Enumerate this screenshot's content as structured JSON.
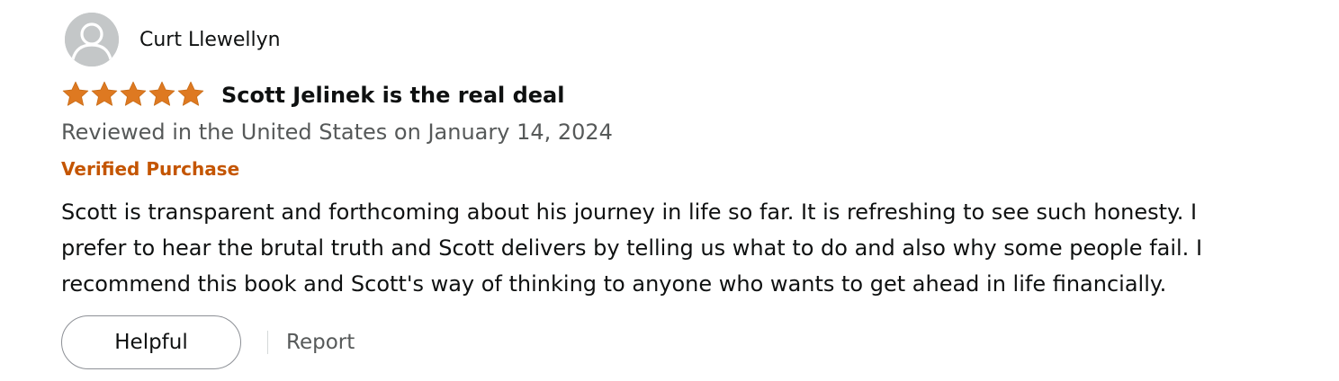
{
  "reviewer": {
    "name": "Curt Llewellyn",
    "avatar_icon": "default-user-avatar-icon"
  },
  "rating": {
    "stars": 5,
    "max_stars": 5,
    "star_icon": "star-icon",
    "star_color": "#de7921"
  },
  "review": {
    "title": "Scott Jelinek is the real deal",
    "date_line": "Reviewed in the United States on January 14, 2024",
    "verified_label": "Verified Purchase",
    "body_lines": [
      "Scott is transparent and forthcoming about his journey in life so far. It is refreshing to see such honesty. I",
      "prefer to hear the brutal truth and Scott delivers by telling us what to do and also why some people fail. I",
      "recommend this book and Scott's way of thinking to anyone who wants to get ahead in life financially."
    ]
  },
  "actions": {
    "helpful_label": "Helpful",
    "report_label": "Report"
  },
  "colors": {
    "text": "#0f1111",
    "secondary_text": "#565959",
    "verified": "#c45500",
    "avatar_bg": "#c4c7c8",
    "button_border": "#8d9096"
  }
}
